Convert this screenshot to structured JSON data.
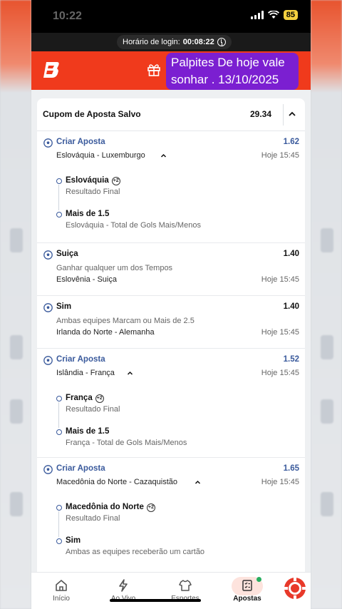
{
  "status": {
    "time": "10:22",
    "battery": "85"
  },
  "login": {
    "label": "Horário de login:",
    "value": "00:08:22"
  },
  "promo": {
    "line1": "Palpites De hoje vale",
    "line2": "sonhar . 13/10/2025"
  },
  "coupon": {
    "title": "Cupom de Aposta Salvo",
    "odds": "29.34"
  },
  "bets": [
    {
      "title": "Criar Aposta",
      "match": "Eslováquia - Luxemburgo",
      "odds": "1.62",
      "time": "Hoje 15:45",
      "legs": [
        {
          "pick": "Eslováquia",
          "badge": "+2",
          "market": "Resultado Final"
        },
        {
          "pick": "Mais de 1.5",
          "market": "Eslováquia - Total de Gols Mais/Menos"
        }
      ]
    },
    {
      "pick": "Suiça",
      "market": "Ganhar qualquer um dos Tempos",
      "match": "Eslovênia - Suiça",
      "odds": "1.40",
      "time": "Hoje 15:45"
    },
    {
      "pick": "Sim",
      "market": "Ambas equipes Marcam ou Mais de 2.5",
      "match": "Irlanda do Norte - Alemanha",
      "odds": "1.40",
      "time": "Hoje 15:45"
    },
    {
      "title": "Criar Aposta",
      "match": "Islândia - França",
      "odds": "1.52",
      "time": "Hoje 15:45",
      "legs": [
        {
          "pick": "França",
          "badge": "+2",
          "market": "Resultado Final"
        },
        {
          "pick": "Mais de 1.5",
          "market": "França - Total de Gols Mais/Menos"
        }
      ]
    },
    {
      "title": "Criar Aposta",
      "match": "Macedônia do Norte - Cazaquistão",
      "odds": "1.65",
      "time": "Hoje 15:45",
      "legs": [
        {
          "pick": "Macedônia do Norte",
          "badge": "+2",
          "market": "Resultado Final"
        },
        {
          "pick": "Sim",
          "market": "Ambas as equipes receberão um cartão"
        }
      ]
    }
  ],
  "nav": {
    "home": "Início",
    "live": "Ao Vivo",
    "sports": "Esportes",
    "bets": "Apostas"
  },
  "colors": {
    "brand": "#f03a1c",
    "promo": "#7b1fd1",
    "link": "#3a5a9c"
  }
}
